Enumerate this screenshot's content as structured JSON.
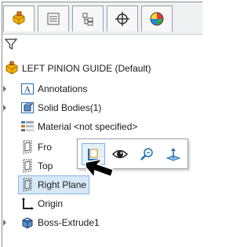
{
  "tabs": [
    {
      "icon": "feature-manager-icon"
    },
    {
      "icon": "property-manager-icon"
    },
    {
      "icon": "configuration-manager-icon"
    },
    {
      "icon": "dimxpert-manager-icon"
    },
    {
      "icon": "display-manager-icon"
    }
  ],
  "filter": {
    "icon": "filter-icon"
  },
  "tree": {
    "root": {
      "label": "LEFT PINION GUIDE  (Default)",
      "icon": "part-icon"
    },
    "items": [
      {
        "label": "Annotations",
        "icon": "annotations-icon"
      },
      {
        "label": "Solid Bodies(1)",
        "icon": "solid-bodies-icon"
      },
      {
        "label": "Material <not specified>",
        "icon": "material-icon"
      },
      {
        "label": "Fro",
        "icon": "plane-icon"
      },
      {
        "label": "Top",
        "icon": "plane-icon"
      },
      {
        "label": "Right Plane",
        "icon": "plane-icon"
      },
      {
        "label": "Origin",
        "icon": "origin-icon"
      },
      {
        "label": "Boss-Extrude1",
        "icon": "boss-extrude-icon"
      }
    ]
  },
  "context_toolbar": [
    {
      "icon": "normal-to-icon"
    },
    {
      "icon": "show-hide-icon"
    },
    {
      "icon": "zoom-to-selection-icon"
    },
    {
      "icon": "normal-axis-icon"
    }
  ],
  "colors": {
    "accent": "#d98a00",
    "selection": "#d7e9f8",
    "blue": "#1f6fb5"
  }
}
